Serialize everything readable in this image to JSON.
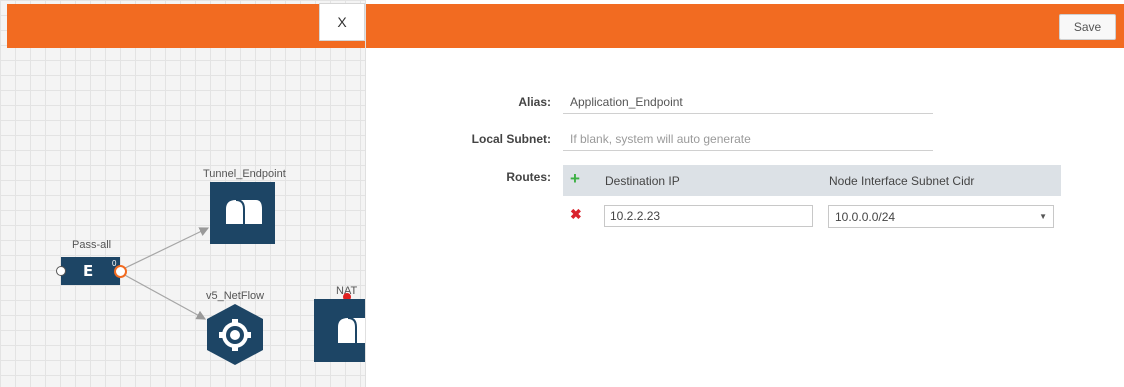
{
  "canvas": {
    "close_label": "X",
    "nodes": {
      "tunnel_endpoint": "Tunnel_Endpoint",
      "pass_all": "Pass-all",
      "v5_netflow": "v5_NetFlow",
      "nat": "NAT",
      "pass_all_port": "0",
      "pass_all_glyph": "E"
    }
  },
  "toolbar": {
    "save_label": "Save"
  },
  "form": {
    "alias": {
      "label": "Alias:",
      "value": "Application_Endpoint"
    },
    "local_subnet": {
      "label": "Local Subnet:",
      "placeholder": "If blank, system will auto generate"
    },
    "routes": {
      "label": "Routes:",
      "columns": [
        "Destination IP",
        "Node Interface Subnet Cidr"
      ],
      "rows": [
        {
          "destination_ip": "10.2.2.23",
          "subnet_cidr": "10.0.0.0/24"
        }
      ]
    }
  },
  "colors": {
    "accent": "#f26b21",
    "node": "#1d4565",
    "add": "#3cb043",
    "remove": "#d9232d"
  }
}
